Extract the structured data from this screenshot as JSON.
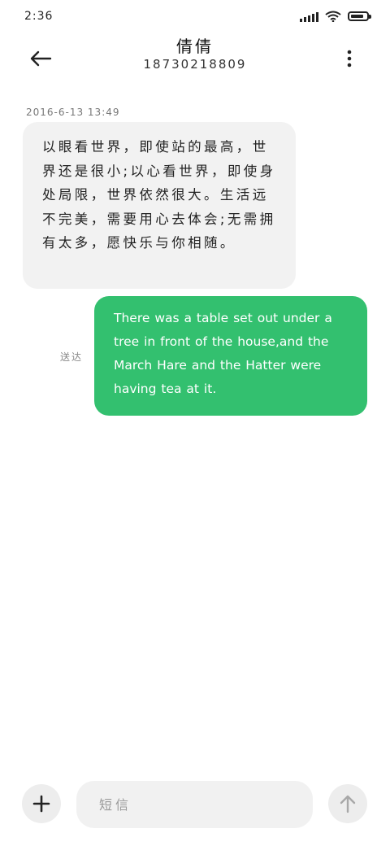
{
  "status_bar": {
    "time": "2:36",
    "icons": [
      "signal-icon",
      "wifi-icon",
      "battery-icon"
    ],
    "battery_level": 0.85
  },
  "header": {
    "back_icon": "arrow-left-icon",
    "contact_name": "倩倩",
    "contact_number": "18730218809",
    "more_icon": "more-vertical-icon"
  },
  "conversation": {
    "timestamp": "2016-6-13 13:49",
    "incoming_message": "以眼看世界，即使站的最高，世界还是很小;以心看世界，即使身处局限，世界依然很大。生活远不完美，需要用心去体会;无需拥有太多，愿快乐与你相随。",
    "outgoing_message": "There was a table set out under a tree in front of the house,and the March Hare and the Hatter were having tea at it.",
    "sent_status": "送达"
  },
  "composer": {
    "add_icon": "plus-icon",
    "placeholder": "短信",
    "send_icon": "arrow-up-icon"
  },
  "colors": {
    "outgoing_bubble": "#33c06f",
    "incoming_bubble": "#f2f2f2",
    "button_bg": "#ededed"
  }
}
